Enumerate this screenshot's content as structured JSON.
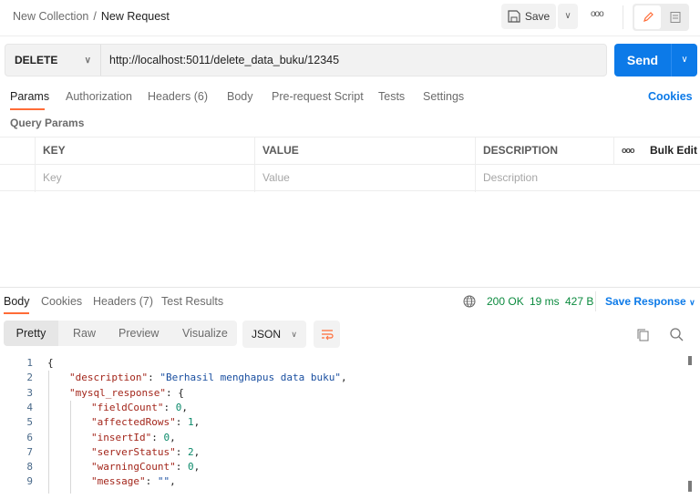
{
  "header": {
    "collection": "New Collection",
    "separator": "/",
    "request": "New Request",
    "save_label": "Save"
  },
  "request": {
    "method": "DELETE",
    "url": "http://localhost:5011/delete_data_buku/12345",
    "send_label": "Send"
  },
  "tabs": [
    {
      "label": "Params"
    },
    {
      "label": "Authorization"
    },
    {
      "label": "Headers",
      "count": "(6)"
    },
    {
      "label": "Body"
    },
    {
      "label": "Pre-request Script"
    },
    {
      "label": "Tests"
    },
    {
      "label": "Settings"
    }
  ],
  "cookies_link": "Cookies",
  "query_params": {
    "title": "Query Params",
    "headers": [
      "KEY",
      "VALUE",
      "DESCRIPTION"
    ],
    "bulk_edit": "Bulk Edit",
    "placeholders": [
      "Key",
      "Value",
      "Description"
    ]
  },
  "response": {
    "tabs": [
      {
        "label": "Body"
      },
      {
        "label": "Cookies"
      },
      {
        "label": "Headers",
        "count": "(7)"
      },
      {
        "label": "Test Results"
      }
    ],
    "status": "200 OK",
    "time": "19 ms",
    "size": "427 B",
    "save_response": "Save Response",
    "views": [
      "Pretty",
      "Raw",
      "Preview",
      "Visualize"
    ],
    "format": "JSON",
    "lines": [
      "1",
      "2",
      "3",
      "4",
      "5",
      "6",
      "7",
      "8",
      "9"
    ],
    "code": [
      {
        "open": "{"
      },
      {
        "key": "\"description\"",
        "val": "\"Berhasil menghapus data buku\"",
        "t": "s"
      },
      {
        "key": "\"mysql_response\"",
        "open": "{"
      },
      {
        "key": "\"fieldCount\"",
        "val": "0",
        "t": "n"
      },
      {
        "key": "\"affectedRows\"",
        "val": "1",
        "t": "n"
      },
      {
        "key": "\"insertId\"",
        "val": "0",
        "t": "n"
      },
      {
        "key": "\"serverStatus\"",
        "val": "2",
        "t": "n"
      },
      {
        "key": "\"warningCount\"",
        "val": "0",
        "t": "n"
      },
      {
        "key": "\"message\"",
        "val": "\"\"",
        "t": "s"
      }
    ]
  },
  "colors": {
    "accent": "#ff6c37",
    "primary": "#0c7ae8",
    "success": "#0b8a3e"
  }
}
